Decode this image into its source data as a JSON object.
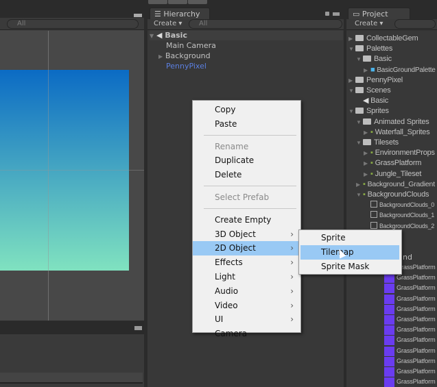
{
  "scene": {
    "search_placeholder": "All",
    "gradient_top": "#0b6bc4",
    "gradient_bottom": "#80e2c0"
  },
  "hierarchy": {
    "tab": "Hierarchy",
    "create": "Create ▾",
    "search_placeholder": "All",
    "scene_name": "Basic",
    "items": [
      {
        "label": "Main Camera",
        "expandable": false
      },
      {
        "label": "Background",
        "expandable": true
      },
      {
        "label": "PennyPixel",
        "expandable": false,
        "selected_color": "#5b7fe0"
      }
    ]
  },
  "project": {
    "tab": "Project",
    "create": "Create ▾",
    "items": [
      {
        "label": "CollectableGem",
        "depth": 0,
        "open": false,
        "icon": "folder-icon"
      },
      {
        "label": "Palettes",
        "depth": 0,
        "open": true,
        "icon": "folder-icon"
      },
      {
        "label": "Basic",
        "depth": 1,
        "open": true,
        "icon": "folder-icon"
      },
      {
        "label": "BasicGroundPalette",
        "depth": 2,
        "open": false,
        "icon": "prefab-cube-icon"
      },
      {
        "label": "PennyPixel",
        "depth": 0,
        "open": false,
        "icon": "folder-icon"
      },
      {
        "label": "Scenes",
        "depth": 0,
        "open": true,
        "icon": "folder-icon"
      },
      {
        "label": "Basic",
        "depth": 1,
        "icon": "unity-scene-icon"
      },
      {
        "label": "Sprites",
        "depth": 0,
        "open": true,
        "icon": "folder-icon"
      },
      {
        "label": "Animated Sprites",
        "depth": 1,
        "open": true,
        "icon": "folder-icon"
      },
      {
        "label": "Waterfall_Sprites",
        "depth": 2,
        "open": false,
        "icon": "sprite-sheet-icon"
      },
      {
        "label": "Tilesets",
        "depth": 1,
        "open": true,
        "icon": "folder-icon"
      },
      {
        "label": "EnvironmentProps",
        "depth": 2,
        "open": false,
        "icon": "sprite-icon"
      },
      {
        "label": "GrassPlatform",
        "depth": 2,
        "open": false,
        "icon": "sprite-icon"
      },
      {
        "label": "Jungle_Tileset",
        "depth": 2,
        "open": false,
        "icon": "sprite-icon"
      },
      {
        "label": "Background_Gradient",
        "depth": 1,
        "open": false,
        "icon": "sprite-icon"
      },
      {
        "label": "BackgroundClouds",
        "depth": 1,
        "open": true,
        "icon": "sprite-icon"
      },
      {
        "label": "BackgroundClouds_0",
        "depth": 2,
        "icon": "tile-icon"
      },
      {
        "label": "BackgroundClouds_1",
        "depth": 2,
        "icon": "tile-icon"
      },
      {
        "label": "BackgroundClouds_2",
        "depth": 2,
        "icon": "tile-icon"
      }
    ],
    "partial_label": "und",
    "grass_items": [
      "GrassPlatform",
      "GrassPlatform",
      "GrassPlatform",
      "GrassPlatform",
      "GrassPlatform",
      "GrassPlatform",
      "GrassPlatform",
      "GrassPlatform",
      "GrassPlatform",
      "GrassPlatform",
      "GrassPlatform",
      "GrassPlatform"
    ]
  },
  "context_menu": {
    "items": [
      {
        "label": "Copy"
      },
      {
        "label": "Paste"
      },
      {
        "sep": true
      },
      {
        "label": "Rename",
        "disabled": true
      },
      {
        "label": "Duplicate"
      },
      {
        "label": "Delete"
      },
      {
        "sep": true
      },
      {
        "label": "Select Prefab",
        "disabled": true
      },
      {
        "sep": true
      },
      {
        "label": "Create Empty"
      },
      {
        "label": "3D Object",
        "submenu": true
      },
      {
        "label": "2D Object",
        "submenu": true,
        "highlighted": true
      },
      {
        "label": "Effects",
        "submenu": true
      },
      {
        "label": "Light",
        "submenu": true
      },
      {
        "label": "Audio",
        "submenu": true
      },
      {
        "label": "Video",
        "submenu": true
      },
      {
        "label": "UI",
        "submenu": true
      },
      {
        "label": "Camera"
      }
    ]
  },
  "submenu": {
    "items": [
      {
        "label": "Sprite"
      },
      {
        "label": "Tilemap",
        "highlighted": true
      },
      {
        "label": "Sprite Mask"
      }
    ]
  },
  "highlight_color": "#99c9f4"
}
